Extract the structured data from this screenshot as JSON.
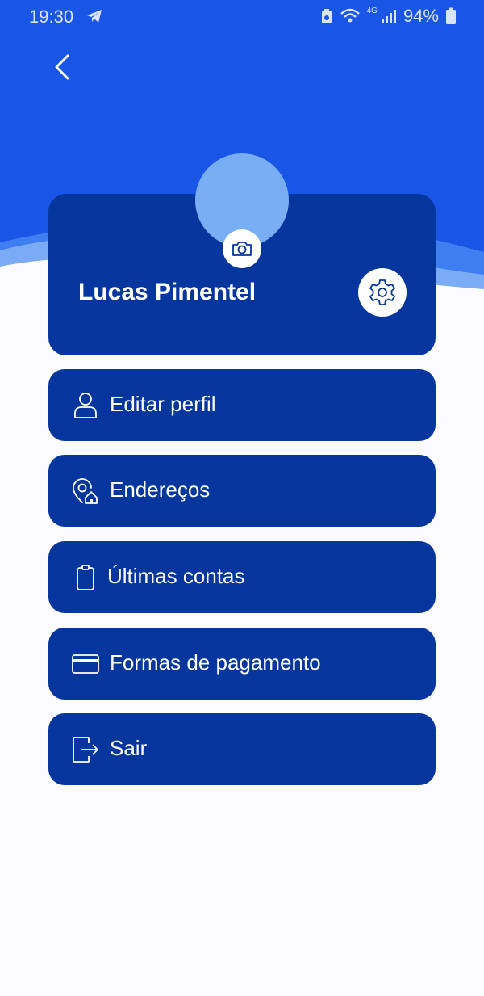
{
  "status_bar": {
    "time": "19:30",
    "network": "4G",
    "battery": "94%"
  },
  "profile": {
    "name": "Lucas Pimentel"
  },
  "menu": {
    "items": [
      {
        "label": "Editar perfil",
        "icon": "person-icon"
      },
      {
        "label": "Endereços",
        "icon": "location-home-icon"
      },
      {
        "label": "Últimas contas",
        "icon": "clipboard-icon"
      },
      {
        "label": "Formas de pagamento",
        "icon": "credit-card-icon"
      },
      {
        "label": "Sair",
        "icon": "logout-icon"
      }
    ]
  },
  "colors": {
    "header_blue": "#1a56e6",
    "wave_light": "#7cabf6",
    "card_navy": "#04369d",
    "avatar": "#78aef4",
    "background": "#fcfcfe"
  }
}
